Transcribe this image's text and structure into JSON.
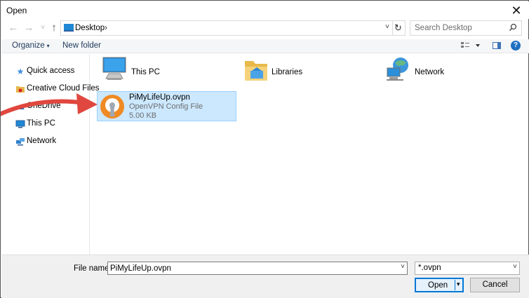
{
  "window": {
    "title": "Open",
    "close_glyph": "✕"
  },
  "nav": {
    "back_glyph": "←",
    "forward_glyph": "→",
    "recent_glyph": "˅",
    "up_glyph": "↑",
    "address_crumb": "Desktop",
    "address_sep": "›",
    "address_dropdown_glyph": "˅",
    "refresh_glyph": "↻",
    "search_placeholder": "Search Desktop"
  },
  "toolbar": {
    "organize_label": "Organize",
    "new_folder_label": "New folder",
    "caret_glyph": "▾",
    "help_glyph": "?"
  },
  "sidebar": {
    "items": [
      {
        "label": "Quick access",
        "icon": "star-icon",
        "glyph": "★",
        "color": "#3d8ee0"
      },
      {
        "label": "Creative Cloud Files",
        "icon": "cloud-folder-icon",
        "glyph": "■",
        "color": "#e5b74a"
      },
      {
        "label": "OneDrive",
        "icon": "onedrive-icon",
        "glyph": "☁",
        "color": "#1f6fc2"
      },
      {
        "label": "This PC",
        "icon": "computer-icon",
        "glyph": "▭",
        "color": "#1f87d4"
      },
      {
        "label": "Network",
        "icon": "network-icon",
        "glyph": "▣",
        "color": "#2f7fc9"
      }
    ]
  },
  "content": {
    "folders": [
      {
        "label": "This PC",
        "icon": "computer-icon"
      },
      {
        "label": "Libraries",
        "icon": "libraries-icon"
      },
      {
        "label": "Network",
        "icon": "network-icon"
      }
    ],
    "file": {
      "name": "PiMyLifeUp.ovpn",
      "type": "OpenVPN Config File",
      "size": "5.00 KB",
      "icon": "openvpn-icon"
    }
  },
  "footer": {
    "file_name_label": "File name:",
    "file_name_value": "PiMyLifeUp.ovpn",
    "filter_value": "*.ovpn",
    "open_label": "Open",
    "cancel_label": "Cancel"
  },
  "colors": {
    "accent": "#0078d7",
    "selection": "#cce8ff",
    "arrow": "#e0473e"
  }
}
